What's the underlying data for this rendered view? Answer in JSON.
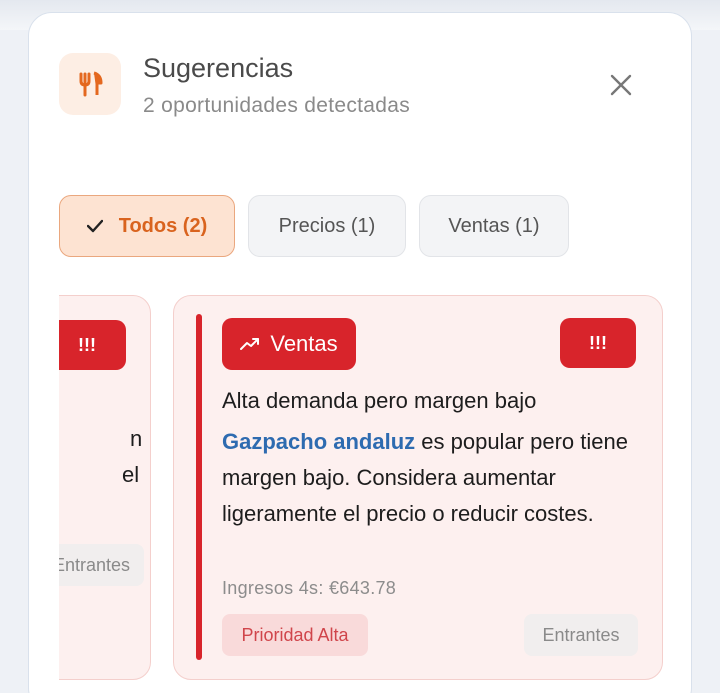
{
  "header": {
    "title": "Sugerencias",
    "subtitle": "2 oportunidades detectadas",
    "icon": "fork-knife-icon"
  },
  "filters": [
    {
      "label": "Todos (2)",
      "active": true
    },
    {
      "label": "Precios (1)",
      "active": false
    },
    {
      "label": "Ventas (1)",
      "active": false
    }
  ],
  "cards": {
    "previous": {
      "priority_badge": "!!!",
      "fragment_line1": "n",
      "fragment_line2": "el",
      "category_tag": "Entrantes"
    },
    "current": {
      "category_badge": "Ventas",
      "priority_badge": "!!!",
      "title": "Alta demanda pero margen bajo",
      "dish": "Gazpacho andaluz",
      "body": " es popular pero tiene margen bajo. Considera aumentar ligeramente el precio o reducir costes.",
      "revenue": "Ingresos 4s: €643.78",
      "priority_label": "Prioridad Alta",
      "category_tag": "Entrantes"
    }
  },
  "colors": {
    "accent_orange": "#d9631e",
    "alert_red": "#d8242b",
    "link_blue": "#2e6bb0"
  }
}
